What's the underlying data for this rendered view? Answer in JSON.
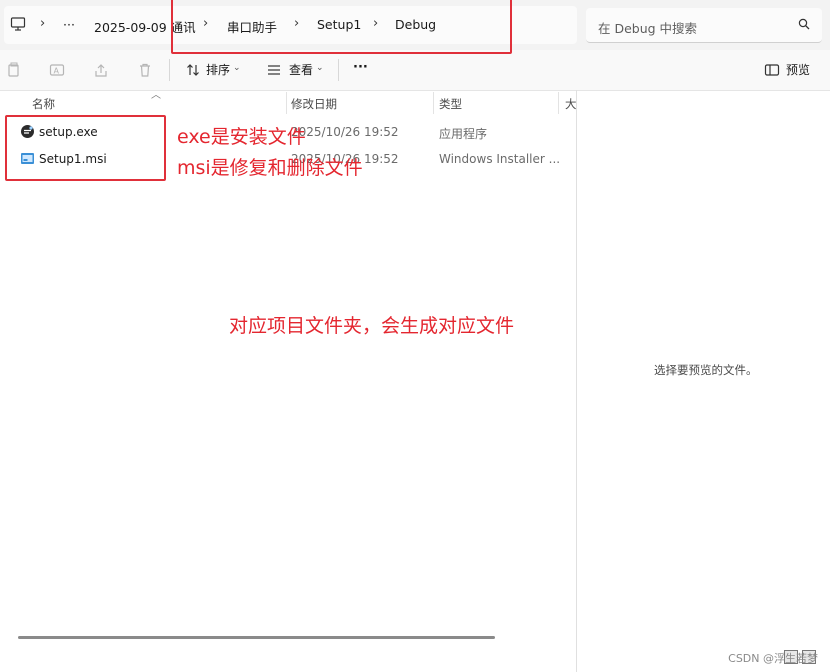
{
  "address_bar": {
    "breadcrumbs": [
      "···",
      "2025-09-09 通讯",
      "串口助手",
      "Setup1",
      "Debug"
    ],
    "search_placeholder": "在 Debug 中搜索"
  },
  "command_bar": {
    "sort_label": "排序",
    "view_label": "查看",
    "more_label": "···",
    "preview_label": "预览"
  },
  "columns": {
    "name": "名称",
    "date": "修改日期",
    "type": "类型",
    "size": "大"
  },
  "files": [
    {
      "name": "setup.exe",
      "date": "2025/10/26 19:52",
      "type": "应用程序",
      "icon": "setup-exe-icon"
    },
    {
      "name": "Setup1.msi",
      "date": "2025/10/26 19:52",
      "type": "Windows Installer ...",
      "icon": "msi-installer-icon"
    }
  ],
  "preview_pane": {
    "empty_text": "选择要预览的文件。"
  },
  "annotations": {
    "exe_note": "exe是安装文件",
    "msi_note": "msi是修复和删除文件",
    "folder_note": "对应项目文件夹，会生成对应文件"
  },
  "watermark": "CSDN @浮生若梦",
  "colors": {
    "annotation_red": "#e4262f"
  }
}
